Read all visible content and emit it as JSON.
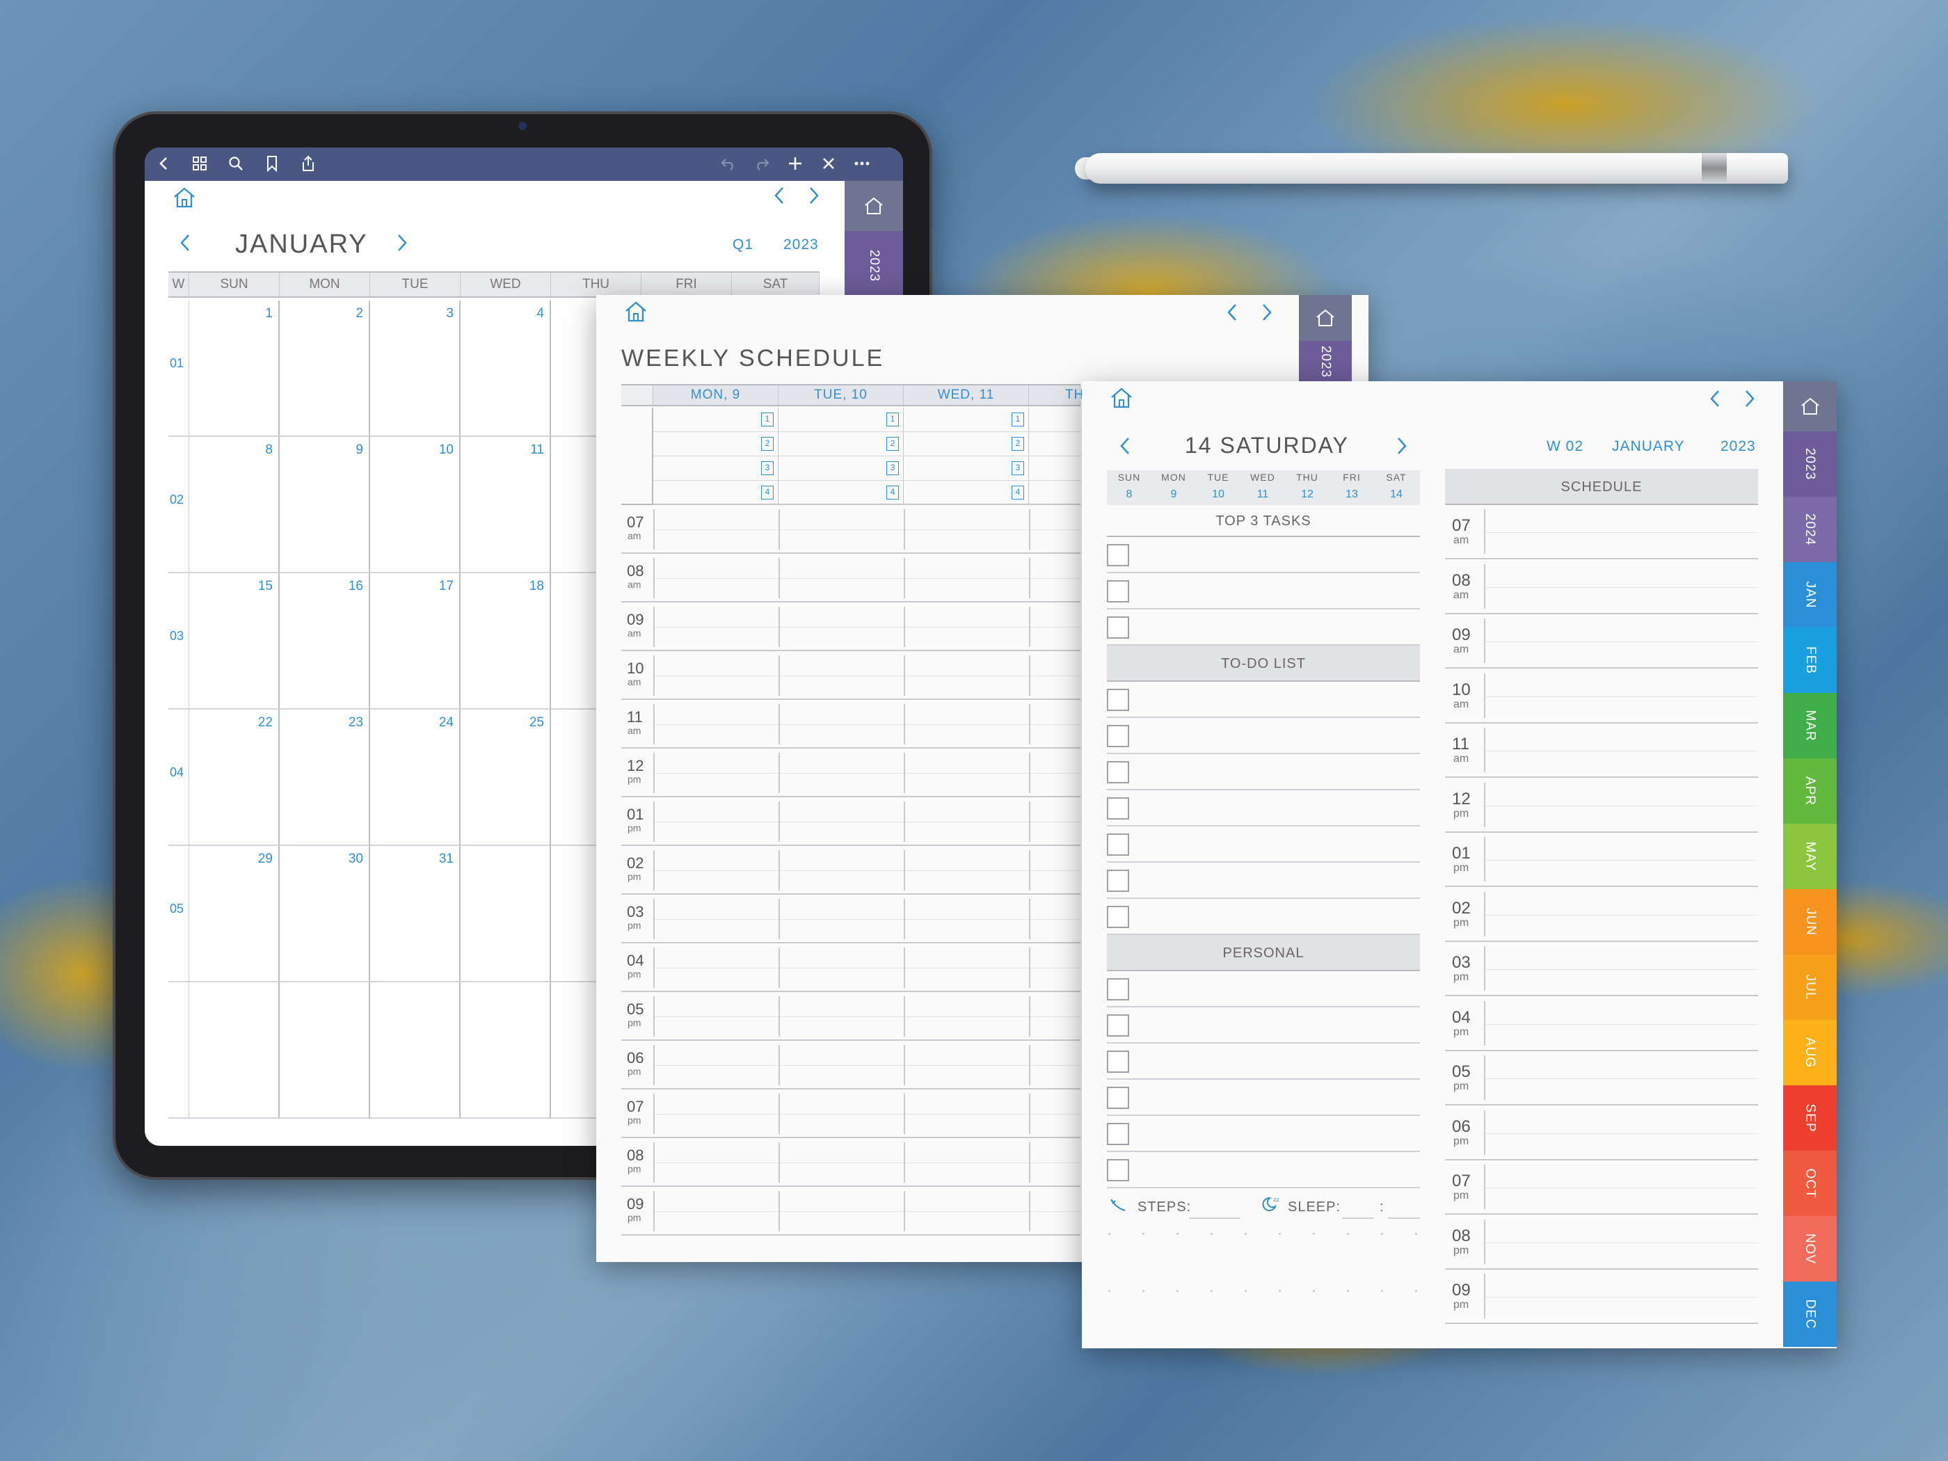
{
  "colors": {
    "accent": "#2f8fd0",
    "appbar": "#4b5783",
    "tab_home": "#6f7590",
    "tab_2023": "#6c5c99",
    "tab_2024": "#7b6aa8"
  },
  "tablet": {
    "toolbar_icons": [
      "back-icon",
      "grid-icon",
      "search-icon",
      "bookmark-icon",
      "share-icon",
      "undo-icon",
      "redo-icon",
      "plus-icon",
      "close-icon",
      "more-icon"
    ],
    "monthly": {
      "month": "JANUARY",
      "quarter": "Q1",
      "year": "2023",
      "week_col": "W",
      "days": [
        "SUN",
        "MON",
        "TUE",
        "WED",
        "THU",
        "FRI",
        "SAT"
      ],
      "week_numbers": [
        "01",
        "02",
        "03",
        "04",
        "05"
      ],
      "dates": [
        [
          "1",
          "2",
          "3",
          "4"
        ],
        [
          "8",
          "9",
          "10",
          "11"
        ],
        [
          "15",
          "16",
          "17",
          "18"
        ],
        [
          "22",
          "23",
          "24",
          "25"
        ],
        [
          "29",
          "30",
          "31",
          ""
        ]
      ]
    },
    "side_tab": "2023"
  },
  "weekly": {
    "title": "WEEKLY SCHEDULE",
    "days": [
      "MON, 9",
      "TUE, 10",
      "WED, 11",
      "THU"
    ],
    "task_numbers": [
      "1",
      "2",
      "3",
      "4"
    ],
    "side_tab": "2023",
    "hours": [
      {
        "h": "07",
        "ap": "am"
      },
      {
        "h": "08",
        "ap": "am"
      },
      {
        "h": "09",
        "ap": "am"
      },
      {
        "h": "10",
        "ap": "am"
      },
      {
        "h": "11",
        "ap": "am"
      },
      {
        "h": "12",
        "ap": "pm"
      },
      {
        "h": "01",
        "ap": "pm"
      },
      {
        "h": "02",
        "ap": "pm"
      },
      {
        "h": "03",
        "ap": "pm"
      },
      {
        "h": "04",
        "ap": "pm"
      },
      {
        "h": "05",
        "ap": "pm"
      },
      {
        "h": "06",
        "ap": "pm"
      },
      {
        "h": "07",
        "ap": "pm"
      },
      {
        "h": "08",
        "ap": "pm"
      },
      {
        "h": "09",
        "ap": "pm"
      }
    ]
  },
  "daily": {
    "date": "14 SATURDAY",
    "week": "W 02",
    "month": "JANUARY",
    "year": "2023",
    "mini_week": [
      {
        "n": "SUN",
        "d": "8"
      },
      {
        "n": "MON",
        "d": "9"
      },
      {
        "n": "TUE",
        "d": "10"
      },
      {
        "n": "WED",
        "d": "11"
      },
      {
        "n": "THU",
        "d": "12"
      },
      {
        "n": "FRI",
        "d": "13"
      },
      {
        "n": "SAT",
        "d": "14"
      }
    ],
    "top_tasks": "TOP 3 TASKS",
    "todo": "TO-DO LIST",
    "personal": "PERSONAL",
    "schedule": "SCHEDULE",
    "steps_label": "STEPS:",
    "sleep_label": "SLEEP:",
    "sleep_sep": ":",
    "hours": [
      {
        "h": "07",
        "ap": "am"
      },
      {
        "h": "08",
        "ap": "am"
      },
      {
        "h": "09",
        "ap": "am"
      },
      {
        "h": "10",
        "ap": "am"
      },
      {
        "h": "11",
        "ap": "am"
      },
      {
        "h": "12",
        "ap": "pm"
      },
      {
        "h": "01",
        "ap": "pm"
      },
      {
        "h": "02",
        "ap": "pm"
      },
      {
        "h": "03",
        "ap": "pm"
      },
      {
        "h": "04",
        "ap": "pm"
      },
      {
        "h": "05",
        "ap": "pm"
      },
      {
        "h": "06",
        "ap": "pm"
      },
      {
        "h": "07",
        "ap": "pm"
      },
      {
        "h": "08",
        "ap": "pm"
      },
      {
        "h": "09",
        "ap": "pm"
      }
    ],
    "tabs": [
      {
        "label": "2023",
        "color": "#6c5c99"
      },
      {
        "label": "2024",
        "color": "#7b6aa8"
      },
      {
        "label": "JAN",
        "color": "#2b8fd8"
      },
      {
        "label": "FEB",
        "color": "#1aa0e0"
      },
      {
        "label": "MAR",
        "color": "#3fae49"
      },
      {
        "label": "APR",
        "color": "#62b83b"
      },
      {
        "label": "MAY",
        "color": "#8cc63e"
      },
      {
        "label": "JUN",
        "color": "#f7941e"
      },
      {
        "label": "JUL",
        "color": "#f9a01b"
      },
      {
        "label": "AUG",
        "color": "#fbb117"
      },
      {
        "label": "SEP",
        "color": "#ee3f2f"
      },
      {
        "label": "OCT",
        "color": "#f05a3f"
      },
      {
        "label": "NOV",
        "color": "#f26b5b"
      },
      {
        "label": "DEC",
        "color": "#2b8fd8"
      }
    ]
  }
}
